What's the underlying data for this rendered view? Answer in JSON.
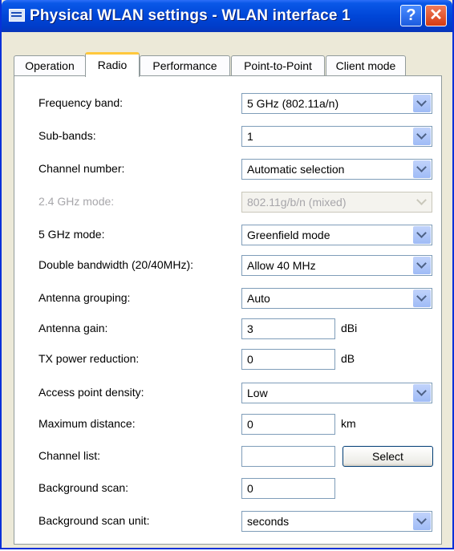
{
  "window": {
    "title": "Physical WLAN settings - WLAN interface 1",
    "help_label": "?",
    "close_label": "✕"
  },
  "tabs": [
    {
      "label": "Operation"
    },
    {
      "label": "Radio"
    },
    {
      "label": "Performance"
    },
    {
      "label": "Point-to-Point"
    },
    {
      "label": "Client mode"
    }
  ],
  "active_tab": "Radio",
  "fields": {
    "frequency_band": {
      "label": "Frequency band:",
      "value": "5 GHz (802.11a/n)"
    },
    "sub_bands": {
      "label": "Sub-bands:",
      "value": "1"
    },
    "channel_number": {
      "label": "Channel number:",
      "value": "Automatic selection"
    },
    "ghz24_mode": {
      "label": "2.4 GHz mode:",
      "value": "802.11g/b/n (mixed)",
      "disabled": true
    },
    "ghz5_mode": {
      "label": "5 GHz mode:",
      "value": "Greenfield mode"
    },
    "double_bandwidth": {
      "label": "Double bandwidth (20/40MHz):",
      "value": "Allow 40 MHz"
    },
    "antenna_grouping": {
      "label": "Antenna grouping:",
      "value": "Auto"
    },
    "antenna_gain": {
      "label": "Antenna gain:",
      "value": "3",
      "unit": "dBi"
    },
    "tx_power_reduction": {
      "label": "TX power reduction:",
      "value": "0",
      "unit": "dB"
    },
    "ap_density": {
      "label": "Access point density:",
      "value": "Low"
    },
    "max_distance": {
      "label": "Maximum distance:",
      "value": "0",
      "unit": "km"
    },
    "channel_list": {
      "label": "Channel list:",
      "value": "",
      "button_label": "Select"
    },
    "background_scan": {
      "label": "Background scan:",
      "value": "0"
    },
    "background_scan_unit": {
      "label": "Background scan unit:",
      "value": "seconds"
    }
  }
}
